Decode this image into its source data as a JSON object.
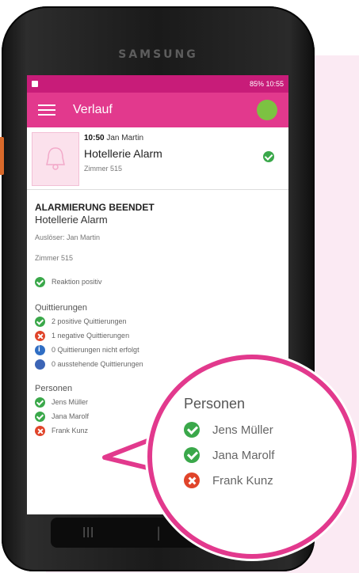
{
  "device": {
    "brand": "SAMSUNG"
  },
  "statusbar": {
    "right_text": "85% 10:55"
  },
  "appbar": {
    "title": "Verlauf"
  },
  "card": {
    "time": "10:50",
    "author": "Jan Martin",
    "title": "Hotellerie Alarm",
    "room": "Zimmer 515"
  },
  "detail": {
    "status": "ALARMIERUNG BEENDET",
    "title": "Hotellerie Alarm",
    "triggered_by": "Auslöser: Jan Martin",
    "room": "Zimmer 515",
    "reaction": "Reaktion positiv"
  },
  "quittierungen": {
    "header": "Quittierungen",
    "items": [
      {
        "status": "ok",
        "text": "2 positive Quittierungen"
      },
      {
        "status": "no",
        "text": "1 negative Quittierungen"
      },
      {
        "status": "info",
        "text": "0 Quittierungen nicht erfolgt"
      },
      {
        "status": "pending",
        "text": "0 ausstehende Quittierungen"
      }
    ]
  },
  "personen": {
    "header": "Personen",
    "items": [
      {
        "status": "ok",
        "name": "Jens Müller"
      },
      {
        "status": "ok",
        "name": "Jana Marolf"
      },
      {
        "status": "no",
        "name": "Frank Kunz"
      }
    ]
  },
  "navbar": {
    "recent": "III",
    "home": "|",
    "back": "○"
  },
  "colors": {
    "accent": "#e2398d",
    "statusbar": "#c81c79",
    "success": "#3aa84a",
    "error": "#e0442a",
    "info": "#2f6ec4"
  },
  "icons": {
    "menu": "hamburger-icon",
    "avatar": "avatar-icon",
    "bell": "bell-icon",
    "check": "check-circle-icon",
    "error": "x-circle-icon"
  }
}
